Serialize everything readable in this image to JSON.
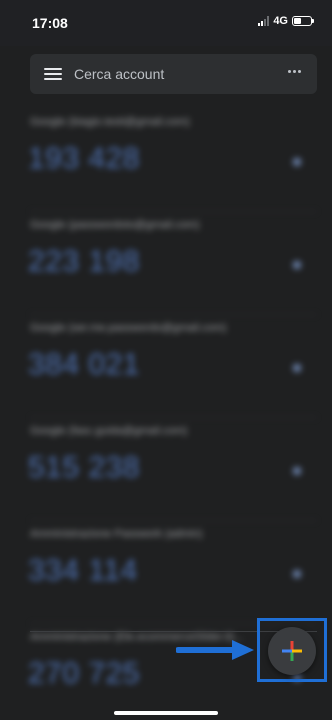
{
  "status_bar": {
    "time": "17:08",
    "network": "4G",
    "signal_bars_active": 2,
    "signal_bars_total": 4,
    "battery_level": 0.45
  },
  "search": {
    "placeholder": "Cerca account",
    "menu_icon": "hamburger-menu-icon",
    "more_icon": "more-horizontal-icon"
  },
  "accounts": [
    {
      "label": "Google (biagio.testi@gmail.com)",
      "code": "193 428"
    },
    {
      "label": "Google (passwordoto@gmail.com)",
      "code": "223 198"
    },
    {
      "label": "Google (ser.me.passwordo@gmail.com)",
      "code": "384 021"
    },
    {
      "label": "Google (fasc.guida@gmail.com)",
      "code": "515 238"
    },
    {
      "label": "Amministrazione Passwork (admin)",
      "code": "334 114"
    },
    {
      "label": "Amministrazione (Ele.ecommerceSlider.it)...",
      "code": "270 725"
    }
  ],
  "fab": {
    "icon": "add-plus-icon"
  },
  "colors": {
    "background": "#1f2021",
    "code_blue": "#5f8ee6",
    "highlight": "#1f6fd6",
    "plus_blue": "#4285f4",
    "plus_red": "#ea4335",
    "plus_yellow": "#fbbc05",
    "plus_green": "#34a853"
  }
}
